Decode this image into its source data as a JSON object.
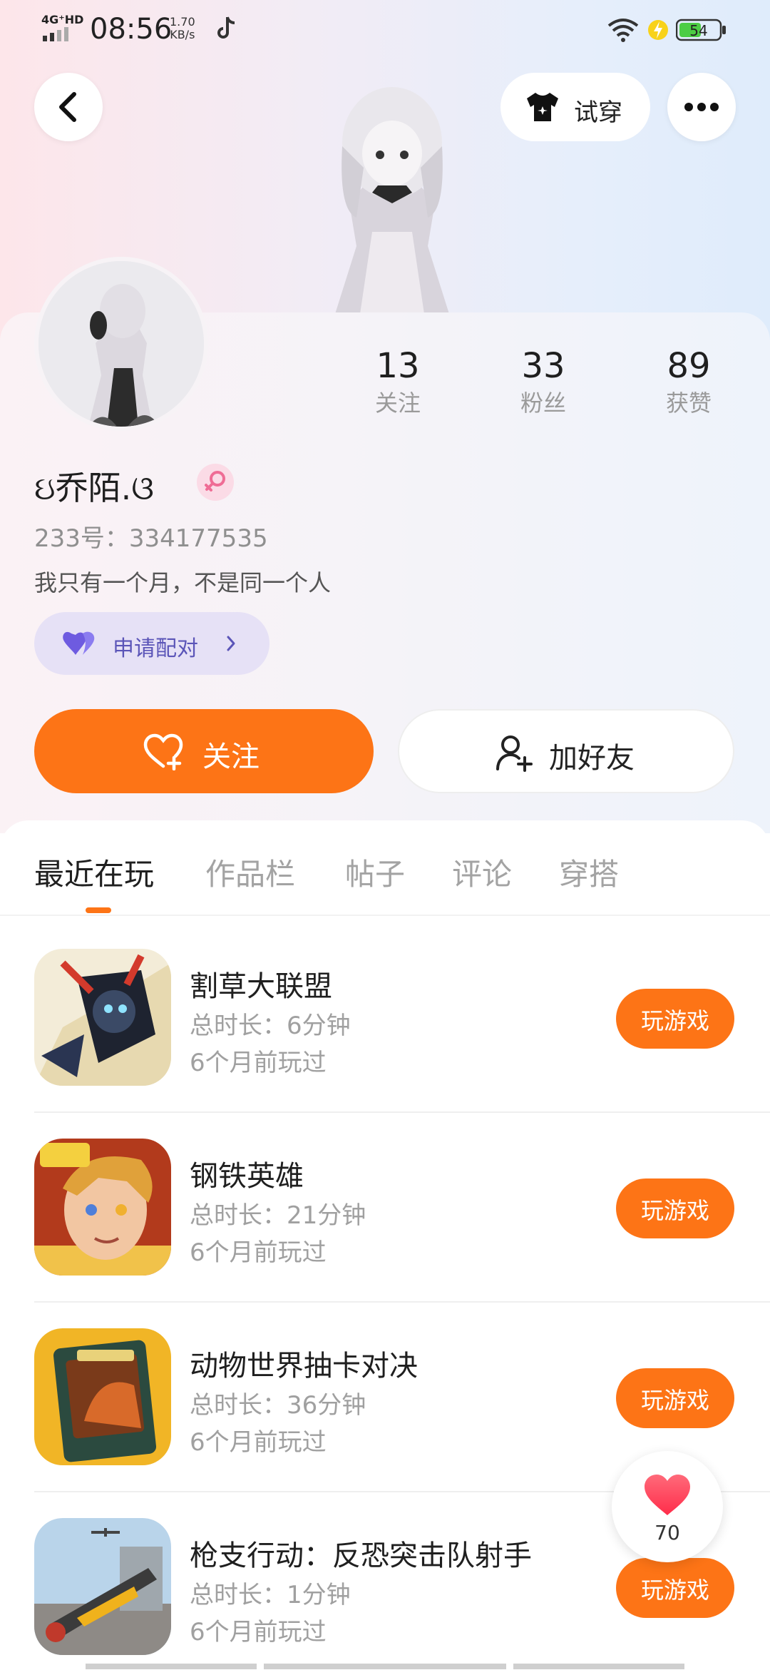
{
  "status_bar": {
    "network": "4G⁺HD",
    "time": "08:56",
    "speed_value": "1.70",
    "speed_unit": "KB/s",
    "battery": "54"
  },
  "header": {
    "tryon_label": "试穿"
  },
  "profile": {
    "stats": [
      {
        "value": "13",
        "label": "关注"
      },
      {
        "value": "33",
        "label": "粉丝"
      },
      {
        "value": "89",
        "label": "获赞"
      }
    ],
    "nickname": "ઇ乔陌.ଓ",
    "uid": "233号：334177535",
    "bio": "我只有一个月，不是同一个人",
    "match_label": "申请配对",
    "follow_label": "关注",
    "add_friend_label": "加好友"
  },
  "tabs": [
    "最近在玩",
    "作品栏",
    "帖子",
    "评论",
    "穿搭"
  ],
  "games": [
    {
      "name": "割草大联盟",
      "duration": "总时长：6分钟",
      "last_played": "6个月前玩过",
      "play_label": "玩游戏"
    },
    {
      "name": "钢铁英雄",
      "duration": "总时长：21分钟",
      "last_played": "6个月前玩过",
      "play_label": "玩游戏"
    },
    {
      "name": "动物世界抽卡对决",
      "duration": "总时长：36分钟",
      "last_played": "6个月前玩过",
      "play_label": "玩游戏"
    },
    {
      "name": "枪支行动：反恐突击队射手",
      "duration": "总时长：1分钟",
      "last_played": "6个月前玩过",
      "play_label": "玩游戏"
    }
  ],
  "like_fab": {
    "count": "70"
  },
  "colors": {
    "accent": "#fd7416",
    "match_bg": "#e6e1f6",
    "match_text": "#5b55b8"
  }
}
